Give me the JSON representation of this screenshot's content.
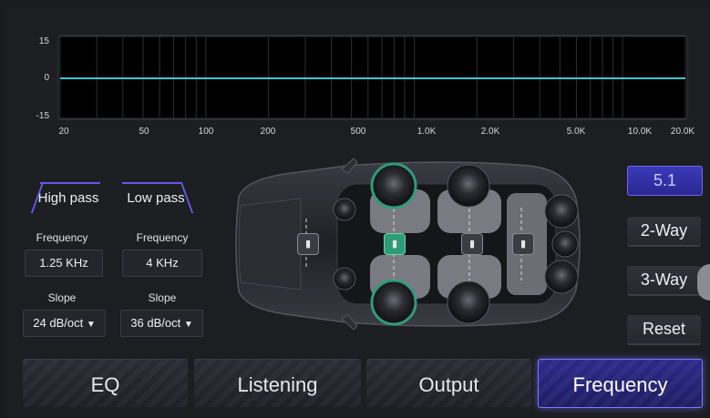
{
  "graph": {
    "y_ticks": [
      "15",
      "0",
      "-15"
    ],
    "x_ticks": [
      "20",
      "50",
      "100",
      "200",
      "500",
      "1.0K",
      "2.0K",
      "5.0K",
      "10.0K",
      "20.0K"
    ],
    "curve_color": "#3cc7d1"
  },
  "filter": {
    "high_pass": {
      "tab_label": "High pass",
      "frequency_label": "Frequency",
      "frequency_value": "1.25 KHz",
      "slope_label": "Slope",
      "slope_value": "24 dB/oct"
    },
    "low_pass": {
      "tab_label": "Low pass",
      "frequency_label": "Frequency",
      "frequency_value": "4 KHz",
      "slope_label": "Slope",
      "slope_value": "36 dB/oct"
    },
    "dropdown_icon": "caret-down-icon"
  },
  "side_buttons": {
    "mode_5_1": "5.1",
    "two_way": "2-Way",
    "three_way": "3-Way",
    "reset": "Reset"
  },
  "tabs": {
    "eq": "EQ",
    "listening": "Listening",
    "output": "Output",
    "frequency": "Frequency"
  },
  "colors": {
    "accent": "#5d5ce8",
    "selected_speaker": "#2f9c78",
    "curve": "#3cc7d1"
  }
}
